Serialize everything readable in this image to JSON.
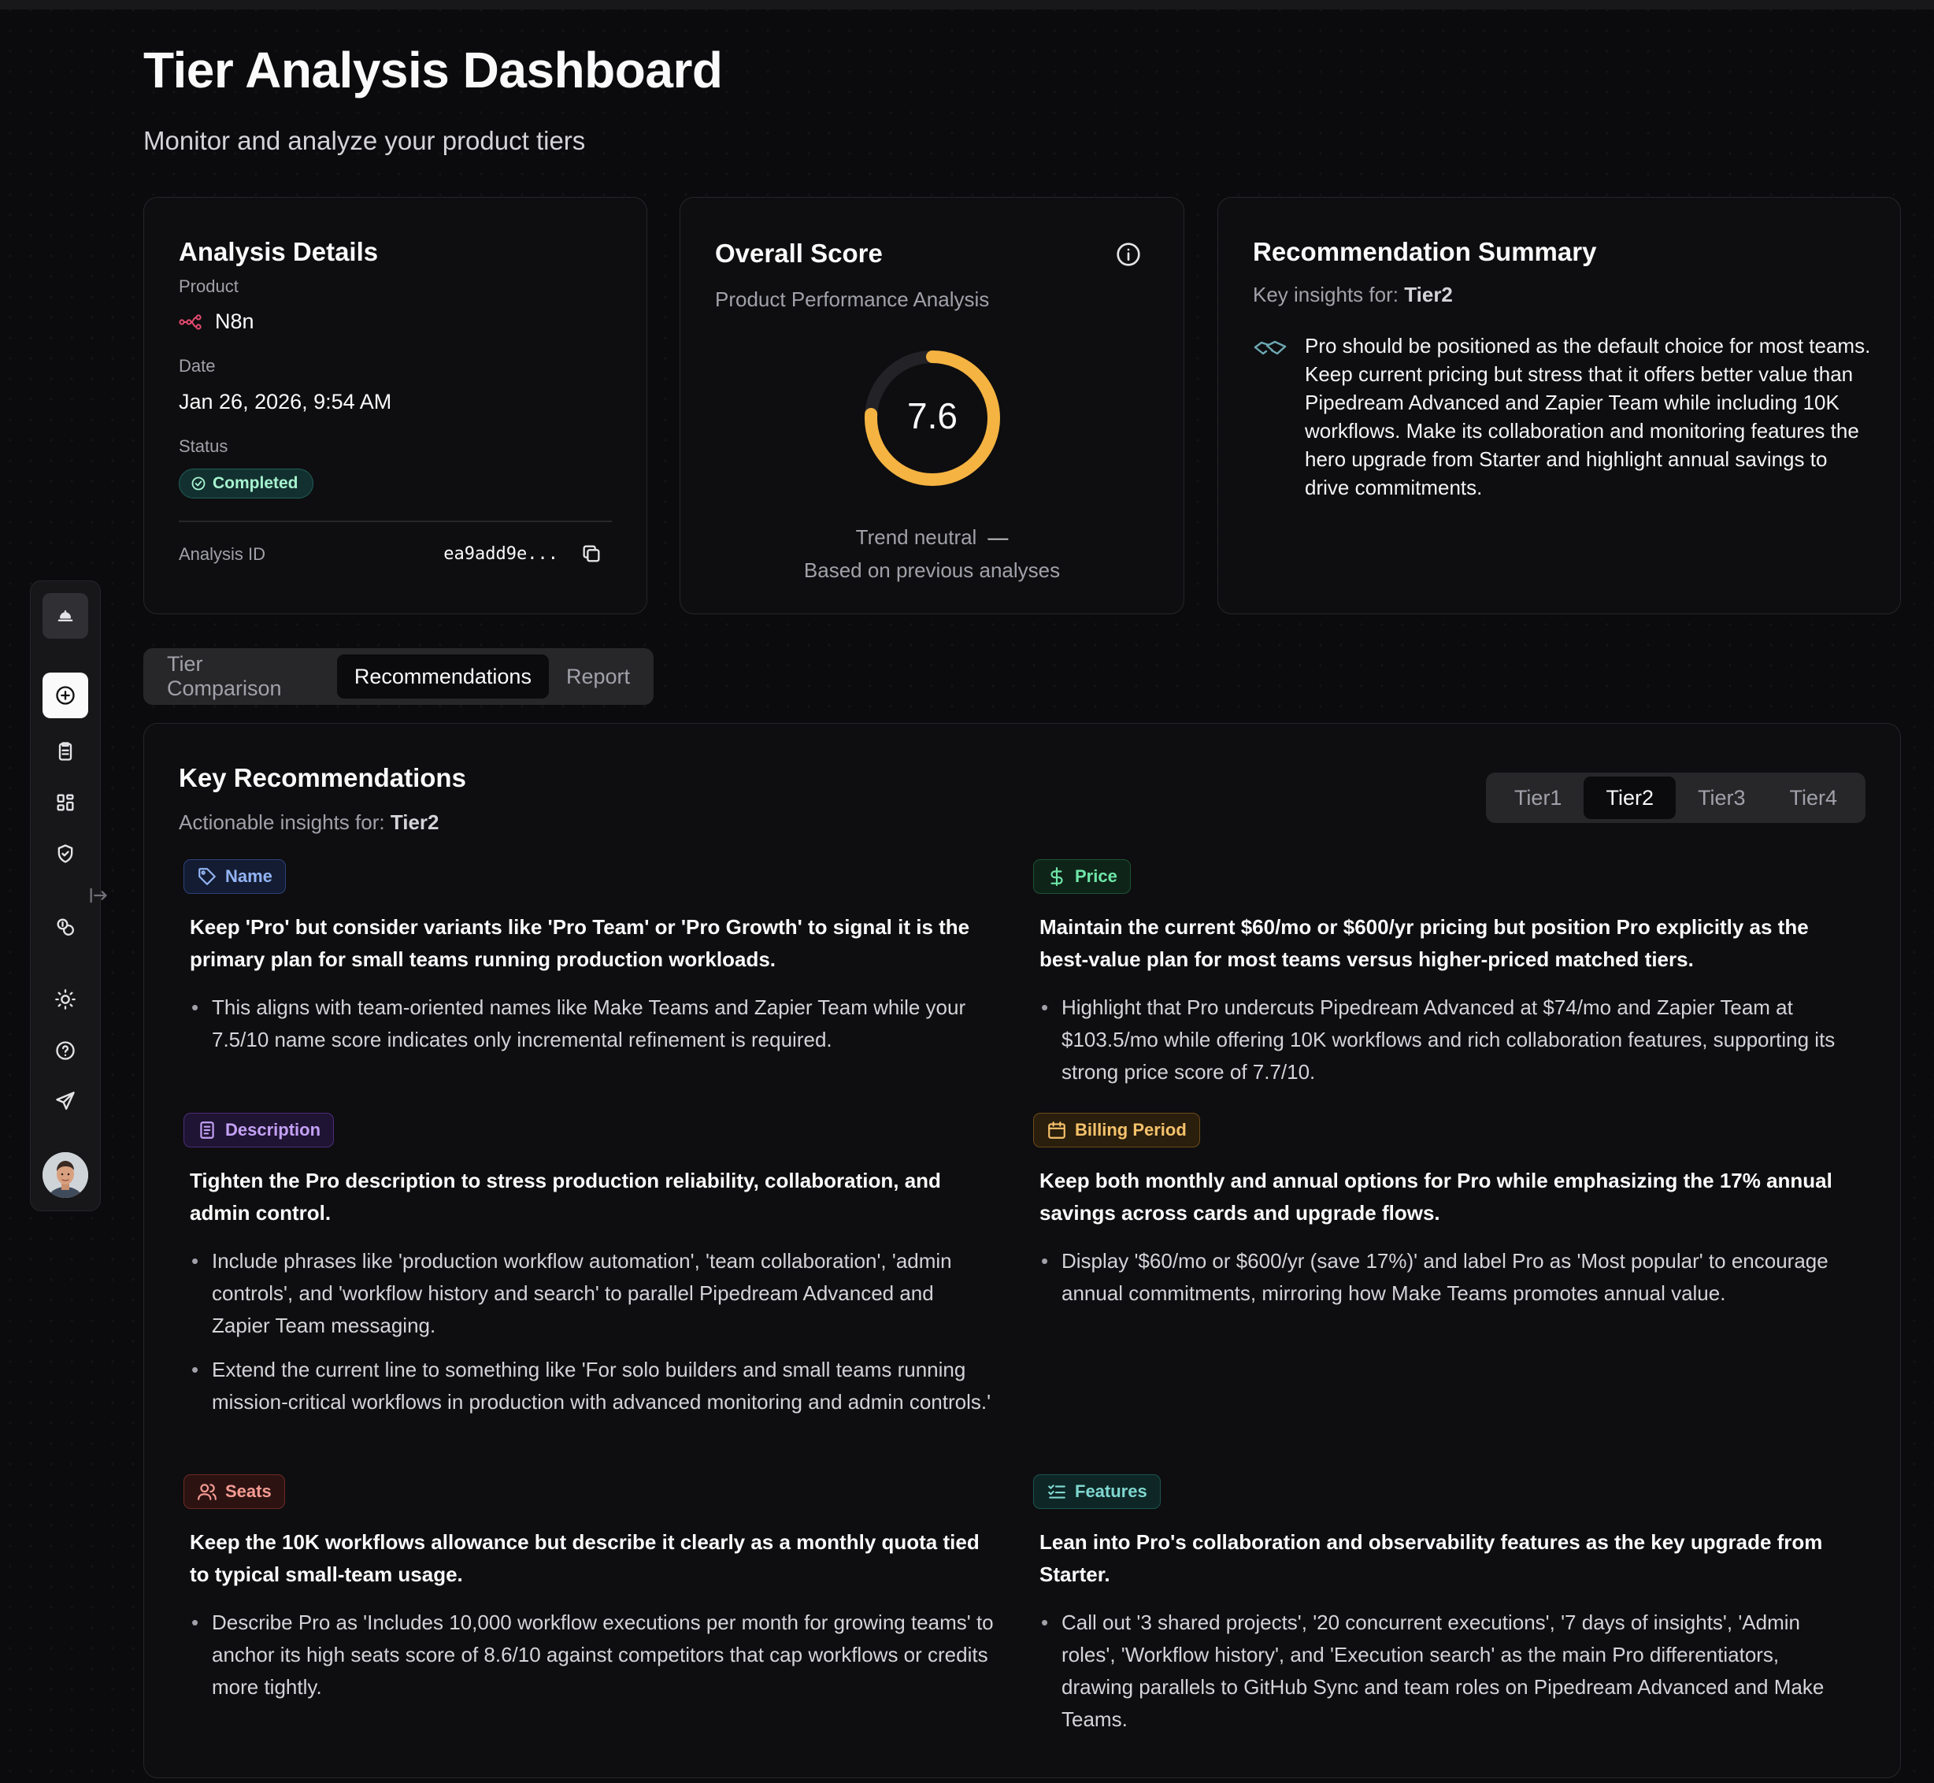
{
  "header": {
    "title": "Tier Analysis Dashboard",
    "subtitle": "Monitor and analyze your product tiers"
  },
  "sidebar": {
    "items": [
      {
        "icon": "app-logo-icon"
      },
      {
        "icon": "plus-circle-icon",
        "active": true
      },
      {
        "icon": "clipboard-icon"
      },
      {
        "icon": "grid-icon"
      },
      {
        "icon": "shield-check-icon"
      },
      {
        "icon": "coins-icon"
      },
      {
        "icon": "sun-icon"
      },
      {
        "icon": "help-circle-icon"
      },
      {
        "icon": "send-icon"
      },
      {
        "icon": "user-avatar"
      }
    ]
  },
  "analysis_details": {
    "title": "Analysis Details",
    "product_label": "Product",
    "product_value": "N8n",
    "date_label": "Date",
    "date_value": "Jan 26, 2026, 9:54 AM",
    "status_label": "Status",
    "status_value": "Completed",
    "id_label": "Analysis ID",
    "id_value": "ea9add9e..."
  },
  "overall_score": {
    "title": "Overall Score",
    "subtitle": "Product Performance Analysis",
    "score": "7.6",
    "score_fraction": 0.76,
    "gauge_color": "#f5b341",
    "trend": "Trend neutral",
    "trend_symbol": "—",
    "based_on": "Based on previous analyses"
  },
  "recommendation_summary": {
    "title": "Recommendation Summary",
    "insights_prefix": "Key insights for:",
    "tier": "Tier2",
    "text": "Pro should be positioned as the default choice for most teams. Keep current pricing but stress that it offers better value than Pipedream Advanced and Zapier Team while including 10K workflows. Make its collaboration and monitoring features the hero upgrade from Starter and highlight annual savings to drive commitments."
  },
  "main_tabs": [
    {
      "label": "Tier Comparison",
      "active": false
    },
    {
      "label": "Recommendations",
      "active": true
    },
    {
      "label": "Report",
      "active": false
    }
  ],
  "key_recommendations": {
    "title": "Key Recommendations",
    "insights_prefix": "Actionable insights for:",
    "tier": "Tier2",
    "tier_tabs": [
      {
        "label": "Tier1",
        "active": false
      },
      {
        "label": "Tier2",
        "active": true
      },
      {
        "label": "Tier3",
        "active": false
      },
      {
        "label": "Tier4",
        "active": false
      }
    ],
    "items": [
      {
        "badge": "Name",
        "icon": "tag-icon",
        "heading": "Keep 'Pro' but consider variants like 'Pro Team' or 'Pro Growth' to signal it is the primary plan for small teams running production workloads.",
        "bullets": [
          "This aligns with team-oriented names like Make Teams and Zapier Team while your 7.5/10 name score indicates only incremental refinement is required."
        ]
      },
      {
        "badge": "Price",
        "icon": "dollar-icon",
        "heading": "Maintain the current $60/mo or $600/yr pricing but position Pro explicitly as the best-value plan for most teams versus higher-priced matched tiers.",
        "bullets": [
          "Highlight that Pro undercuts Pipedream Advanced at $74/mo and Zapier Team at $103.5/mo while offering 10K workflows and rich collaboration features, supporting its strong price score of 7.7/10."
        ]
      },
      {
        "badge": "Description",
        "icon": "document-icon",
        "heading": "Tighten the Pro description to stress production reliability, collaboration, and admin control.",
        "bullets": [
          "Include phrases like 'production workflow automation', 'team collaboration', 'admin controls', and 'workflow history and search' to parallel Pipedream Advanced and Zapier Team messaging.",
          "Extend the current line to something like 'For solo builders and small teams running mission-critical workflows in production with advanced monitoring and admin controls.'"
        ]
      },
      {
        "badge": "Billing Period",
        "icon": "calendar-icon",
        "heading": "Keep both monthly and annual options for Pro while emphasizing the 17% annual savings across cards and upgrade flows.",
        "bullets": [
          "Display '$60/mo or $600/yr (save 17%)' and label Pro as 'Most popular' to encourage annual commitments, mirroring how Make Teams promotes annual value."
        ]
      },
      {
        "badge": "Seats",
        "icon": "users-icon",
        "heading": "Keep the 10K workflows allowance but describe it clearly as a monthly quota tied to typical small-team usage.",
        "bullets": [
          "Describe Pro as 'Includes 10,000 workflow executions per month for growing teams' to anchor its high seats score of 8.6/10 against competitors that cap workflows or credits more tightly."
        ]
      },
      {
        "badge": "Features",
        "icon": "checklist-icon",
        "heading": "Lean into Pro's collaboration and observability features as the key upgrade from Starter.",
        "bullets": [
          "Call out '3 shared projects', '20 concurrent executions', '7 days of insights', 'Admin roles', 'Workflow history', and 'Execution search' as the main Pro differentiators, drawing parallels to GitHub Sync and team roles on Pipedream Advanced and Make Teams."
        ]
      }
    ]
  }
}
